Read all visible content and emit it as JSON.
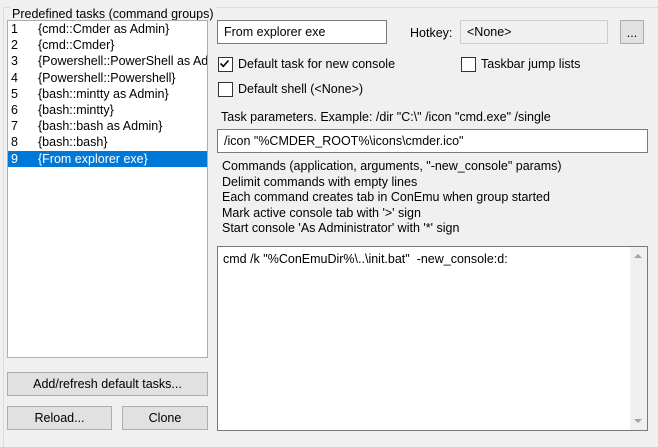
{
  "group_title": "Predefined tasks (command groups)",
  "tasks": [
    {
      "num": "1",
      "name": "{cmd::Cmder as Admin}"
    },
    {
      "num": "2",
      "name": "{cmd::Cmder}"
    },
    {
      "num": "3",
      "name": "{Powershell::PowerShell as Admin}"
    },
    {
      "num": "4",
      "name": "{Powershell::Powershell}"
    },
    {
      "num": "5",
      "name": "{bash::mintty as Admin}"
    },
    {
      "num": "6",
      "name": "{bash::mintty}"
    },
    {
      "num": "7",
      "name": "{bash::bash as Admin}"
    },
    {
      "num": "8",
      "name": "{bash::bash}"
    },
    {
      "num": "9",
      "name": "{From explorer exe}"
    }
  ],
  "selected_task": "9",
  "task_name_value": "From explorer exe",
  "hotkey": {
    "label": "Hotkey:",
    "value": "<None>",
    "browse_label": "..."
  },
  "checkboxes": {
    "default_task": {
      "label": "Default task for new console",
      "checked": true
    },
    "taskbar_jump": {
      "label": "Taskbar jump lists",
      "checked": false
    },
    "default_shell": {
      "label": "Default shell (<None>)",
      "checked": false
    }
  },
  "task_params": {
    "label": "Task parameters. Example: /dir \"C:\\\" /icon \"cmd.exe\" /single",
    "value": "/icon \"%CMDER_ROOT%\\icons\\cmder.ico\""
  },
  "help_lines": [
    "Commands (application, arguments, \"-new_console\" params)",
    "Delimit commands with empty lines",
    "Each command creates tab in ConEmu when group started",
    "Mark active console tab with '>' sign",
    "Start console 'As Administrator' with '*' sign"
  ],
  "commands_value": "cmd /k \"%ConEmuDir%\\..\\init.bat\"  -new_console:d:",
  "buttons": {
    "add_refresh": "Add/refresh default tasks...",
    "reload": "Reload...",
    "clone": "Clone"
  },
  "colors": {
    "selection": "#0078d7",
    "background": "#f0f0f0"
  }
}
